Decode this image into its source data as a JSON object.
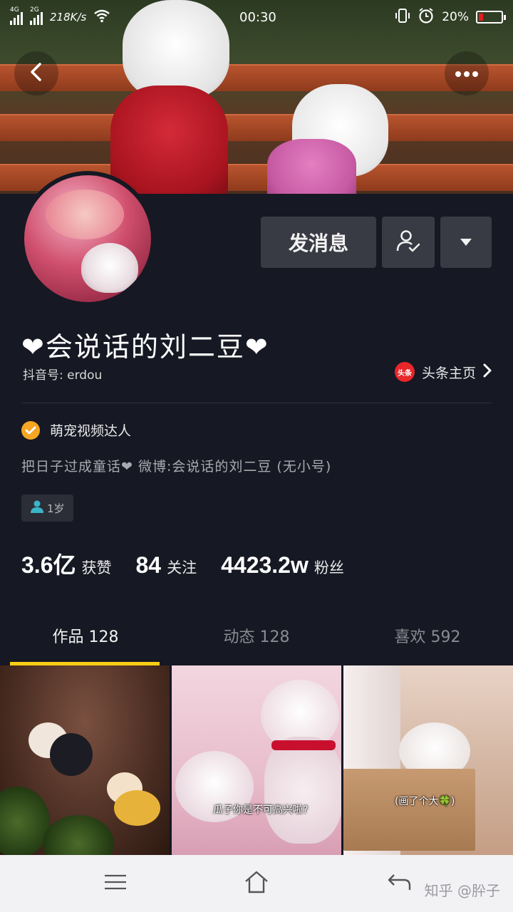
{
  "status_bar": {
    "network_type_1": "4G",
    "network_type_2": "2G",
    "speed": "218K/s",
    "time": "00:30",
    "battery": "20%",
    "battery_level": 0.2
  },
  "profile": {
    "nickname": "❤会说话的刘二豆❤",
    "douyin_id": "抖音号: erdou",
    "toutiao_badge": "头条",
    "toutiao_link": "头条主页",
    "verified": "萌宠视频达人",
    "bio": "把日子过成童话❤ 微博:会说话的刘二豆 (无小号)",
    "age_tag": "1岁"
  },
  "actions": {
    "message_label": "发消息"
  },
  "stats": [
    {
      "value": "3.6亿",
      "label": "获赞"
    },
    {
      "value": "84",
      "label": "关注"
    },
    {
      "value": "4423.2w",
      "label": "粉丝"
    }
  ],
  "tabs": [
    {
      "label": "作品 128",
      "active": true
    },
    {
      "label": "动态 128",
      "active": false
    },
    {
      "label": "喜欢 592",
      "active": false
    }
  ],
  "videos": [
    {
      "caption": ""
    },
    {
      "caption": "瓜子你是不可高兴啦?"
    },
    {
      "caption": "(画了个大🍀)"
    }
  ],
  "watermark": "知乎 @肸子",
  "colors": {
    "background": "#161823",
    "accent": "#face15",
    "button": "#393b44",
    "verified": "#f5a623",
    "toutiao": "#e8272b"
  },
  "icons": [
    "back-icon",
    "more-icon",
    "follow-user-icon",
    "dropdown-icon",
    "chevron-right-icon",
    "verified-icon",
    "person-icon",
    "menu-icon",
    "home-icon",
    "back-nav-icon",
    "wifi-icon",
    "alarm-icon",
    "vibrate-icon"
  ]
}
